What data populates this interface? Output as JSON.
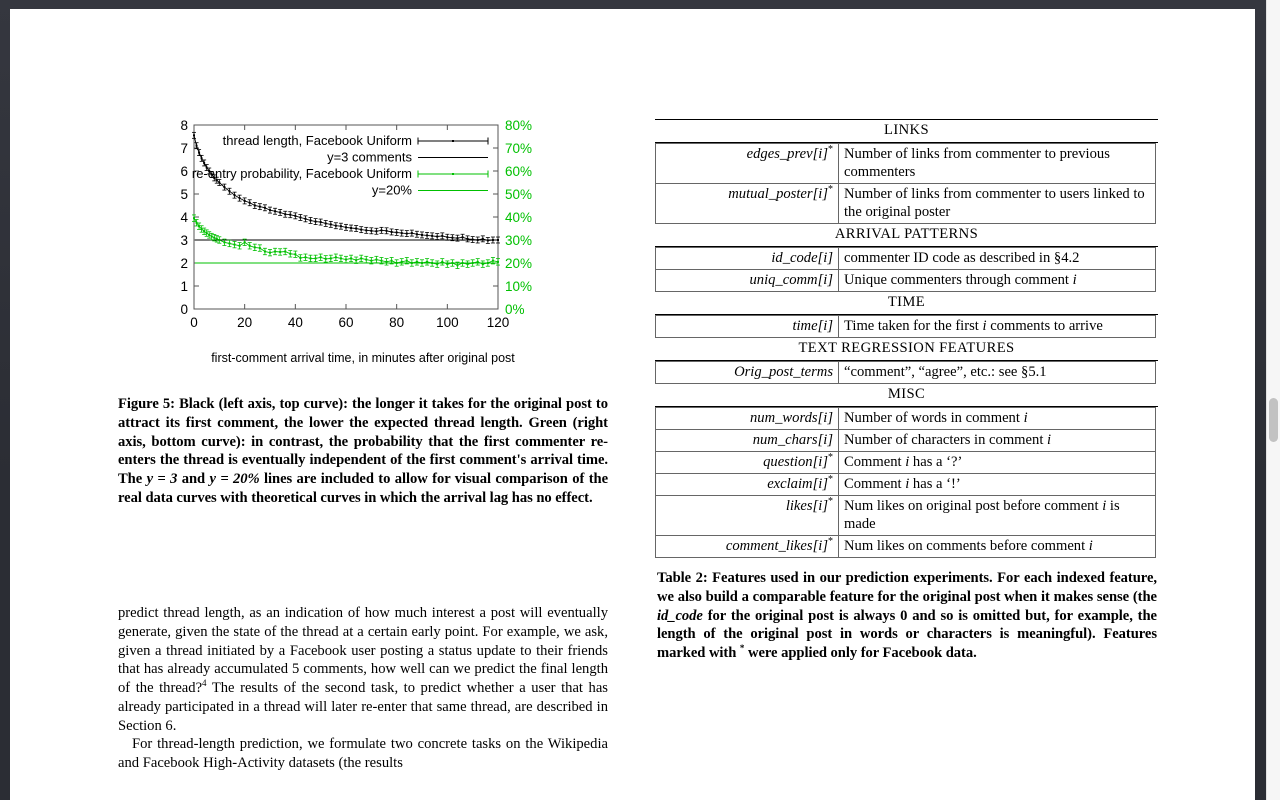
{
  "window": {
    "frame_color": "#2e3038",
    "page_background": "#ffffff",
    "scrollbar": {
      "track_color": "#f6f6f6",
      "thumb_color": "#c2c2c2",
      "thumb_position_pct": 50
    }
  },
  "chart_data": {
    "type": "line",
    "title": "",
    "xlabel": "first-comment arrival time, in minutes after original post",
    "ylabel_left": "",
    "ylabel_right": "",
    "xlim": [
      0,
      120
    ],
    "x_ticks": [
      "0",
      "20",
      "40",
      "60",
      "80",
      "100",
      "120"
    ],
    "x_tick_values": [
      0,
      20,
      40,
      60,
      80,
      100,
      120
    ],
    "ylim_left": [
      0,
      8
    ],
    "y_ticks_left": [
      "0",
      "1",
      "2",
      "3",
      "4",
      "5",
      "6",
      "7",
      "8"
    ],
    "y_tick_values_left": [
      0,
      1,
      2,
      3,
      4,
      5,
      6,
      7,
      8
    ],
    "ylim_right": [
      0,
      80
    ],
    "y_ticks_right": [
      "0%",
      "10%",
      "20%",
      "30%",
      "40%",
      "50%",
      "60%",
      "70%",
      "80%"
    ],
    "y_tick_values_right": [
      0,
      10,
      20,
      30,
      40,
      50,
      60,
      70,
      80
    ],
    "grid": false,
    "legend_position": "top-right-inside",
    "left_axis_color": "#000000",
    "right_axis_color": "#00c000",
    "legend": [
      {
        "label": "thread length, Facebook Uniform",
        "color": "#000000",
        "style": "errorbar-points"
      },
      {
        "label": "y=3 comments",
        "color": "#000000",
        "style": "line"
      },
      {
        "label": "re-entry probability, Facebook Uniform",
        "color": "#00c000",
        "style": "errorbar-points"
      },
      {
        "label": "y=20%",
        "color": "#00c000",
        "style": "line"
      }
    ],
    "series": [
      {
        "name": "thread length, Facebook Uniform",
        "axis": "left",
        "color": "#000000",
        "x": [
          0,
          1,
          2,
          3,
          4,
          5,
          6,
          7,
          8,
          9,
          10,
          12,
          14,
          16,
          18,
          20,
          22,
          24,
          26,
          28,
          30,
          32,
          34,
          36,
          38,
          40,
          42,
          44,
          46,
          48,
          50,
          52,
          54,
          56,
          58,
          60,
          62,
          64,
          66,
          68,
          70,
          72,
          74,
          76,
          78,
          80,
          82,
          84,
          86,
          88,
          90,
          92,
          94,
          96,
          98,
          100,
          102,
          104,
          106,
          108,
          110,
          112,
          114,
          116,
          118,
          120
        ],
        "values": [
          7.55,
          7.1,
          6.8,
          6.55,
          6.35,
          6.15,
          6.0,
          5.85,
          5.7,
          5.6,
          5.5,
          5.3,
          5.12,
          4.95,
          4.82,
          4.7,
          4.62,
          4.5,
          4.45,
          4.4,
          4.3,
          4.25,
          4.2,
          4.12,
          4.1,
          4.05,
          3.98,
          3.92,
          3.85,
          3.8,
          3.78,
          3.72,
          3.68,
          3.62,
          3.6,
          3.55,
          3.52,
          3.5,
          3.45,
          3.42,
          3.4,
          3.38,
          3.42,
          3.4,
          3.35,
          3.33,
          3.3,
          3.28,
          3.3,
          3.25,
          3.22,
          3.2,
          3.18,
          3.15,
          3.18,
          3.12,
          3.1,
          3.08,
          3.12,
          3.05,
          3.02,
          3.0,
          3.05,
          2.98,
          3.0,
          3.0
        ],
        "error": 0.13
      },
      {
        "name": "re-entry probability, Facebook Uniform",
        "axis": "right",
        "color": "#00c000",
        "x": [
          0,
          1,
          2,
          3,
          4,
          5,
          6,
          7,
          8,
          9,
          10,
          12,
          14,
          16,
          18,
          20,
          22,
          24,
          26,
          28,
          30,
          32,
          34,
          36,
          38,
          40,
          42,
          44,
          46,
          48,
          50,
          52,
          54,
          56,
          58,
          60,
          62,
          64,
          66,
          68,
          70,
          72,
          74,
          76,
          78,
          80,
          82,
          84,
          86,
          88,
          90,
          92,
          94,
          96,
          98,
          100,
          102,
          104,
          106,
          108,
          110,
          112,
          114,
          116,
          118,
          120
        ],
        "values": [
          39.5,
          37.5,
          36.0,
          34.8,
          33.8,
          33.0,
          32.2,
          31.5,
          31.0,
          30.5,
          30.0,
          29.0,
          28.5,
          28.0,
          27.5,
          29.0,
          27.5,
          26.8,
          26.5,
          25.0,
          24.5,
          25.0,
          24.8,
          25.0,
          24.0,
          23.8,
          22.2,
          22.5,
          22.0,
          22.0,
          22.5,
          21.8,
          22.0,
          22.5,
          22.0,
          21.5,
          22.0,
          21.2,
          22.0,
          21.5,
          21.0,
          21.5,
          21.0,
          20.5,
          21.0,
          20.0,
          20.5,
          21.0,
          20.0,
          20.5,
          20.0,
          20.5,
          20.0,
          19.5,
          20.5,
          19.5,
          20.0,
          19.0,
          20.0,
          19.5,
          20.0,
          20.5,
          19.5,
          20.0,
          21.0,
          20.5
        ],
        "error": 1.4
      },
      {
        "name": "y=3 comments",
        "axis": "left",
        "color": "#000000",
        "type": "hline",
        "value": 3
      },
      {
        "name": "y=20%",
        "axis": "right",
        "color": "#00c000",
        "type": "hline",
        "value": 20
      }
    ]
  },
  "figure_caption": {
    "label": "Figure 5:",
    "text_part1": " Black (left axis, top curve): the longer it takes for the original post to attract its first comment, the lower the expected thread length.  Green (right axis, bottom curve): in contrast, the probability that the first commenter re-enters the thread is eventually independent of the first comment's arrival time. The ",
    "math1": "y = 3",
    "text_part2": " and ",
    "math2": "y = 20%",
    "text_part3": " lines are included to allow for visual comparison of the real data curves with theoretical curves in which the arrival lag has no effect."
  },
  "body": {
    "paragraph1": "predict thread length, as an indication of how much interest a post will eventually generate, given the state of the thread at a certain early point. For example, we ask, given a thread initiated by a Facebook user posting a status update to their friends that has already accumulated 5 comments, how well can we predict the final length of the thread?",
    "footnote_marker": "4",
    "paragraph1b": " The results of the second task, to predict whether a user that has already participated in a thread will later re-enter that same thread, are described in Section 6.",
    "paragraph2": "For thread-length prediction, we formulate two concrete tasks on the Wikipedia and Facebook High-Activity datasets (the results"
  },
  "table2": {
    "groups": [
      {
        "heading": "LINKS",
        "rows": [
          {
            "key": "edges_prev[i]",
            "star": "*",
            "desc": "Number of links from commenter to previous commenters"
          },
          {
            "key": "mutual_poster[i]",
            "star": "*",
            "desc": "Number of links from commenter to users linked to the original poster"
          }
        ]
      },
      {
        "heading": "ARRIVAL PATTERNS",
        "rows": [
          {
            "key": "id_code[i]",
            "star": "",
            "desc": "commenter ID code as described in §4.2"
          },
          {
            "key": "uniq_comm[i]",
            "star": "",
            "desc": "Unique commenters through comment i"
          }
        ]
      },
      {
        "heading": "TIME",
        "rows": [
          {
            "key": "time[i]",
            "star": "",
            "desc": "Time taken for the first i comments to arrive"
          }
        ]
      },
      {
        "heading": "TEXT REGRESSION FEATURES",
        "rows": [
          {
            "key": "Orig_post_terms",
            "star": "",
            "desc": "“comment”, “agree”, etc.: see §5.1"
          }
        ]
      },
      {
        "heading": "MISC",
        "rows": [
          {
            "key": "num_words[i]",
            "star": "",
            "desc": "Number of words in comment i"
          },
          {
            "key": "num_chars[i]",
            "star": "",
            "desc": "Number of characters in comment i"
          },
          {
            "key": "question[i]",
            "star": "*",
            "desc": "Comment i has a ‘?’"
          },
          {
            "key": "exclaim[i]",
            "star": "*",
            "desc": "Comment i has a ‘!’"
          },
          {
            "key": "likes[i]",
            "star": "*",
            "desc": "Num likes on original post before comment i is made"
          },
          {
            "key": "comment_likes[i]",
            "star": "*",
            "desc": "Num likes on comments before comment i"
          }
        ]
      }
    ],
    "caption_label": "Table 2:",
    "caption_part1": " Features used in our prediction experiments. For each indexed feature, we also build a comparable feature for the original post when it makes sense (the ",
    "caption_math": "id_code",
    "caption_part2": " for the original post is always 0 and so is omitted but, for example, the length of the original post in words or characters is meaningful). Features marked with ",
    "caption_star": "*",
    "caption_part3": " were applied only for Facebook data."
  }
}
